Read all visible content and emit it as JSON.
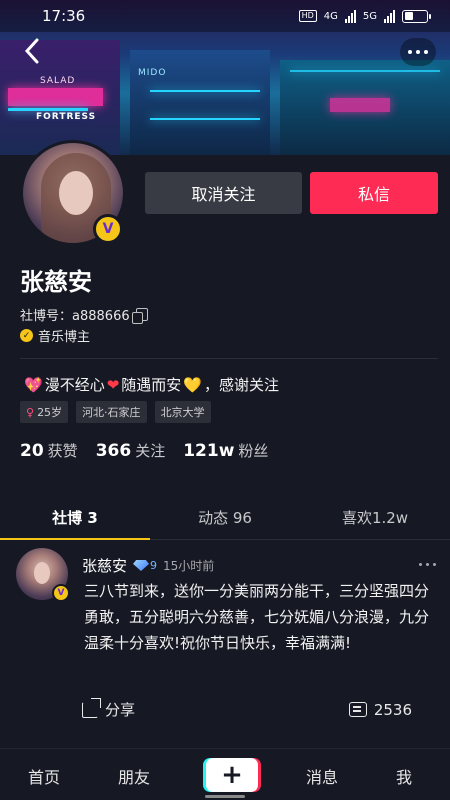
{
  "status_bar": {
    "time": "17:36",
    "hd": "HD",
    "network_1": "4G",
    "network_2": "5G"
  },
  "banner": {
    "sign_1": "FORTRESS",
    "sign_2": "MIDO",
    "sign_3": "SALAD"
  },
  "profile": {
    "name": "张慈安",
    "account_label": "社博号：",
    "account_id": "a888666",
    "role": "音乐博主",
    "bio_part1": "漫不经心",
    "bio_part2": "随遇而安",
    "bio_part3": "，感谢关注",
    "tags": {
      "age": "25岁",
      "location": "河北·石家庄",
      "school": "北京大学"
    },
    "stats": {
      "likes_num": "20",
      "likes_label": "获赞",
      "following_num": "366",
      "following_label": "关注",
      "followers_num": "121w",
      "followers_label": "粉丝"
    }
  },
  "actions": {
    "unfollow_label": "取消关注",
    "message_label": "私信"
  },
  "tabs": [
    {
      "label": "社博 3"
    },
    {
      "label": "动态 96"
    },
    {
      "label": "喜欢1.2w"
    }
  ],
  "post": {
    "author": "张慈安",
    "vip_level": "9",
    "time": "15小时前",
    "content": "三八节到来，送你一分美丽两分能干，三分坚强四分勇敢，五分聪明六分慈善，七分妩媚八分浪漫，九分温柔十分喜欢!祝你节日快乐，幸福满满!",
    "share_label": "分享",
    "comment_count": "2536"
  },
  "bottom_nav": {
    "home": "首页",
    "friends": "朋友",
    "messages": "消息",
    "me": "我"
  },
  "colors": {
    "accent": "#fe2c55",
    "background": "#161823",
    "badge": "#f5c518"
  }
}
